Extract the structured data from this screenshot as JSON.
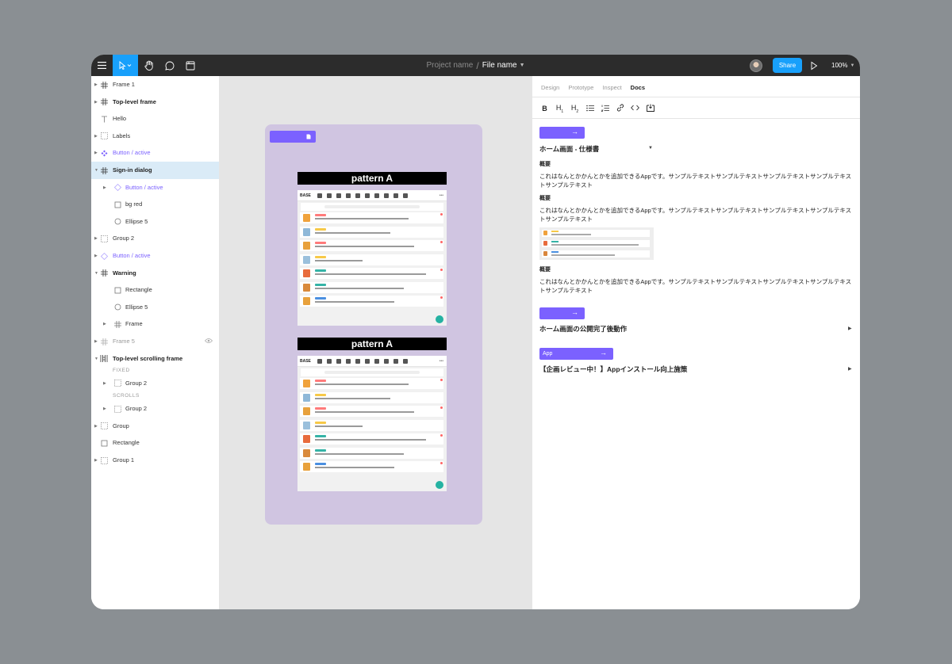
{
  "toolbar": {
    "project_name": "Project name",
    "separator": "/",
    "file_name": "File name",
    "share_label": "Share",
    "zoom": "100%"
  },
  "layers": {
    "items": [
      {
        "label": "Frame 1",
        "icon": "frame-icon"
      },
      {
        "label": "Top-level frame",
        "icon": "frame-icon"
      },
      {
        "label": "Hello",
        "icon": "text-icon"
      },
      {
        "label": "Labels",
        "icon": "group-icon"
      },
      {
        "label": "Button / active",
        "icon": "component-icon"
      },
      {
        "label": "Sign-in dialog",
        "icon": "frame-icon"
      },
      {
        "label": "Button / active",
        "icon": "instance-icon"
      },
      {
        "label": "bg red",
        "icon": "rectangle-icon"
      },
      {
        "label": "Ellipse 5",
        "icon": "ellipse-icon"
      },
      {
        "label": "Group 2",
        "icon": "group-icon"
      },
      {
        "label": "Button / active",
        "icon": "instance-icon"
      },
      {
        "label": "Warning",
        "icon": "frame-icon"
      },
      {
        "label": "Rectangle",
        "icon": "rectangle-icon"
      },
      {
        "label": "Ellipse 5",
        "icon": "ellipse-icon"
      },
      {
        "label": "Frame",
        "icon": "frame-icon"
      },
      {
        "label": "Frame 5",
        "icon": "frame-icon"
      },
      {
        "label": "Top-level scrolling frame",
        "icon": "scroll-frame-icon"
      },
      {
        "label": "Group 2",
        "icon": "group-icon"
      },
      {
        "label": "Group 2",
        "icon": "group-icon"
      },
      {
        "label": "Group",
        "icon": "group-icon"
      },
      {
        "label": "Rectangle",
        "icon": "rectangle-icon"
      },
      {
        "label": "Group 1",
        "icon": "group-icon"
      }
    ],
    "section_fixed": "FIXED",
    "section_scrolls": "SCROLLS"
  },
  "canvas": {
    "pattern_a_title": "pattern A",
    "pattern_b_title": "pattern A",
    "mock_logo": "BASE"
  },
  "props": {
    "tabs": [
      "Design",
      "Prototype",
      "Inspect",
      "Docs"
    ],
    "active_tab": "Docs",
    "format_tools": [
      "B",
      "H1",
      "H2",
      "bullet-list",
      "numbered-list",
      "link",
      "code",
      "embed"
    ],
    "doc": {
      "section1_title": "ホーム画面 - 仕様書",
      "sub1": "概要",
      "para1": "これはなんとかかんとかを追加できるAppです。サンプルテキストサンプルテキストサンプルテキストサンプルテキストサンプルテキスト",
      "sub2": "概要",
      "para2": "これはなんとかかんとかを追加できるAppです。サンプルテキストサンプルテキストサンプルテキストサンプルテキストサンプルテキスト",
      "sub3": "概要",
      "para3": "これはなんとかかんとかを追加できるAppです。サンプルテキストサンプルテキストサンプルテキストサンプルテキストサンプルテキスト",
      "section2_title": "ホーム画面の公開完了後動作",
      "tag3_label": "App",
      "section3_title": "【企画レビュー中！】Appインストール向上施策"
    }
  },
  "colors": {
    "accent": "#18a0fb",
    "purple": "#7b61ff",
    "frame_bg": "#d0c5e1",
    "toolbar_bg": "#2c2c2c"
  }
}
